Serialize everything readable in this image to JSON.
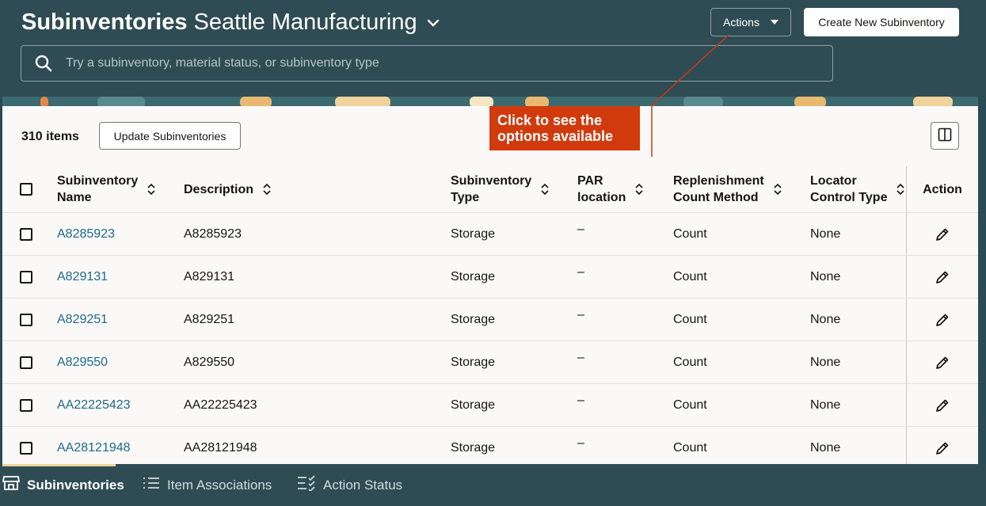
{
  "header": {
    "title_bold": "Subinventories",
    "title_org": "Seattle Manufacturing",
    "actions_label": "Actions",
    "create_label": "Create New Subinventory",
    "search_placeholder": "Try a subinventory, material status, or subinventory type"
  },
  "toolbar": {
    "items_count": "310 items",
    "update_label": "Update Subinventories"
  },
  "callout": {
    "text_line1": "Click to see the",
    "text_line2": "options available",
    "color": "#d13a0d"
  },
  "table": {
    "columns": {
      "name_l1": "Subinventory",
      "name_l2": "Name",
      "desc": "Description",
      "type_l1": "Subinventory",
      "type_l2": "Type",
      "par_l1": "PAR",
      "par_l2": "location",
      "rep_l1": "Replenishment",
      "rep_l2": "Count Method",
      "loc_l1": "Locator",
      "loc_l2": "Control Type",
      "action": "Action"
    },
    "rows": [
      {
        "name": "A8285923",
        "desc": "A8285923",
        "type": "Storage",
        "par": "–",
        "rep": "Count",
        "loc": "None"
      },
      {
        "name": "A829131",
        "desc": "A829131",
        "type": "Storage",
        "par": "–",
        "rep": "Count",
        "loc": "None"
      },
      {
        "name": "A829251",
        "desc": "A829251",
        "type": "Storage",
        "par": "–",
        "rep": "Count",
        "loc": "None"
      },
      {
        "name": "A829550",
        "desc": "A829550",
        "type": "Storage",
        "par": "–",
        "rep": "Count",
        "loc": "None"
      },
      {
        "name": "AA22225423",
        "desc": "AA22225423",
        "type": "Storage",
        "par": "–",
        "rep": "Count",
        "loc": "None"
      },
      {
        "name": "AA28121948",
        "desc": "AA28121948",
        "type": "Storage",
        "par": "–",
        "rep": "Count",
        "loc": "None"
      }
    ]
  },
  "bottom_nav": {
    "tabs": [
      {
        "label": "Subinventories",
        "icon": "store-icon"
      },
      {
        "label": "Item Associations",
        "icon": "list-icon"
      },
      {
        "label": "Action Status",
        "icon": "checklist-icon"
      }
    ]
  },
  "colors": {
    "header_bg": "#2f4c54",
    "link": "#1b6a8c",
    "panel_bg": "#fbf9f8",
    "active_tab_indicator": "#ecd39a"
  }
}
